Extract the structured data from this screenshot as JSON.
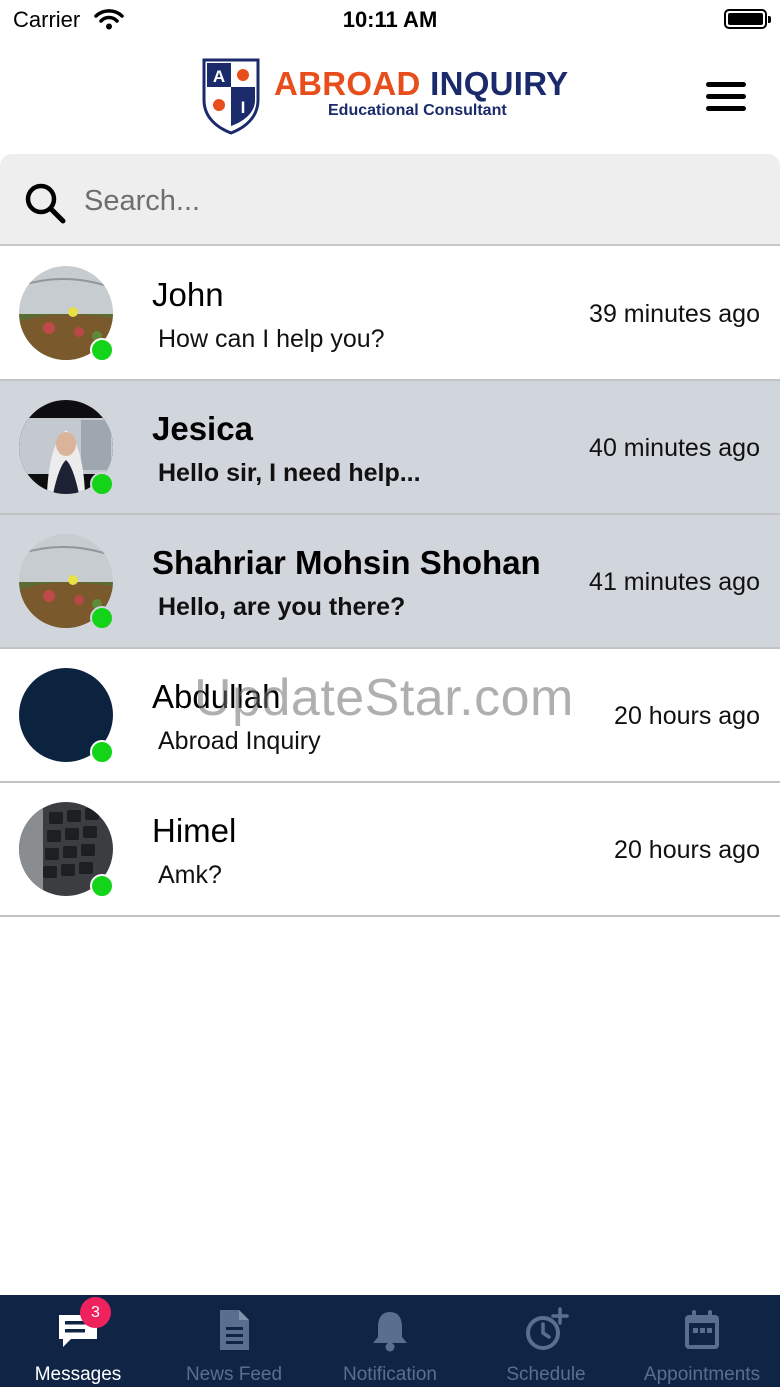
{
  "status_bar": {
    "carrier": "Carrier",
    "time": "10:11 AM"
  },
  "header": {
    "brand_part1": "ABROAD",
    "brand_part2": "INQUIRY",
    "brand_subtitle": "Educational Consultant",
    "logo_letters": [
      "A",
      "I"
    ]
  },
  "search": {
    "placeholder": "Search..."
  },
  "conversations": [
    {
      "name": "John",
      "preview": "How can I help you?",
      "time": "39 minutes ago",
      "unread": false,
      "online": true,
      "avatar": "landscape-photo"
    },
    {
      "name": "Jesica",
      "preview": "Hello sir, I need help...",
      "time": "40 minutes ago",
      "unread": true,
      "online": true,
      "avatar": "portrait-photo"
    },
    {
      "name": "Shahriar Mohsin Shohan",
      "preview": "Hello, are you there?",
      "time": "41 minutes ago",
      "unread": true,
      "online": true,
      "avatar": "landscape-photo"
    },
    {
      "name": "Abdullah",
      "preview": "Abroad Inquiry",
      "time": "20 hours ago",
      "unread": false,
      "online": true,
      "avatar": "solid-navy"
    },
    {
      "name": "Himel",
      "preview": "Amk?",
      "time": "20 hours ago",
      "unread": false,
      "online": true,
      "avatar": "keyboard-photo"
    }
  ],
  "watermark": "UpdateStar.com",
  "tabs": [
    {
      "label": "Messages",
      "icon": "chat-icon",
      "badge": "3",
      "active": true
    },
    {
      "label": "News Feed",
      "icon": "document-icon",
      "active": false
    },
    {
      "label": "Notification",
      "icon": "bell-icon",
      "active": false
    },
    {
      "label": "Schedule",
      "icon": "clock-plus-icon",
      "active": false
    },
    {
      "label": "Appointments",
      "icon": "calendar-icon",
      "active": false
    }
  ],
  "colors": {
    "accent_navy": "#102446",
    "brand_orange": "#e84e1b",
    "brand_navy": "#1b2a6b",
    "online_green": "#14d41a",
    "badge_pink": "#f0225e",
    "unread_row": "#d1d5dc"
  }
}
